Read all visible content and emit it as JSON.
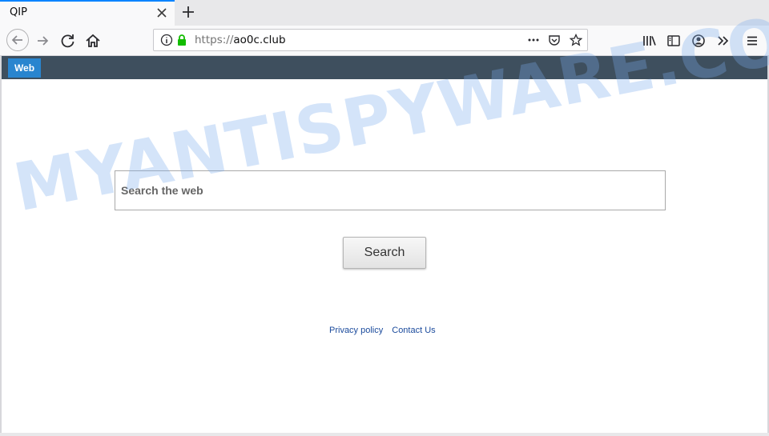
{
  "browser": {
    "tab_title": "QIP",
    "url_scheme": "https://",
    "url_host": "ao0c.club",
    "icons": [
      "close-icon",
      "plus-icon",
      "back-arrow-icon",
      "forward-arrow-icon",
      "reload-icon",
      "home-icon",
      "info-icon",
      "lock-icon",
      "more-icon",
      "pocket-icon",
      "star-icon",
      "library-icon",
      "sidebar-icon",
      "account-icon",
      "overflow-icon",
      "menu-icon"
    ],
    "accent_color": "#0a84ff"
  },
  "site": {
    "nav_tab_label": "Web",
    "search_placeholder": "Search the web",
    "search_button": "Search",
    "footer": {
      "privacy": "Privacy policy",
      "contact": "Contact Us"
    },
    "header_color": "#3e4f5e",
    "tab_color": "#2985cf"
  },
  "watermark": "MYANTISPYWARE.COM"
}
